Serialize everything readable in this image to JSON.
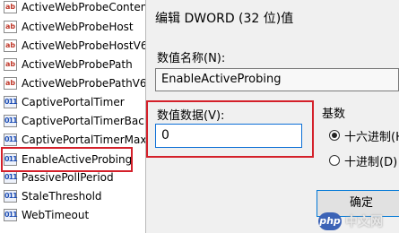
{
  "value_list": {
    "items": [
      {
        "label": "ActiveWebProbeContentV6",
        "type": "sz"
      },
      {
        "label": "ActiveWebProbeHost",
        "type": "sz"
      },
      {
        "label": "ActiveWebProbeHostV6",
        "type": "sz"
      },
      {
        "label": "ActiveWebProbePath",
        "type": "sz"
      },
      {
        "label": "ActiveWebProbePathV6",
        "type": "sz"
      },
      {
        "label": "CaptivePortalTimer",
        "type": "dword"
      },
      {
        "label": "CaptivePortalTimerBack",
        "type": "dword"
      },
      {
        "label": "CaptivePortalTimerMax",
        "type": "dword"
      },
      {
        "label": "EnableActiveProbing",
        "type": "dword"
      },
      {
        "label": "PassivePollPeriod",
        "type": "dword"
      },
      {
        "label": "StaleThreshold",
        "type": "dword"
      },
      {
        "label": "WebTimeout",
        "type": "dword"
      }
    ],
    "icon_text": {
      "sz": "ab",
      "dword": "011"
    },
    "selected_label": "EnableActiveProbing"
  },
  "dialog": {
    "title": "编辑 DWORD (32 位)值",
    "name_label": "数值名称(N):",
    "name_value": "EnableActiveProbing",
    "data_label": "数值数据(V):",
    "data_value": "0",
    "base_label": "基数",
    "radio_hex": "十六进制(H)",
    "radio_dec": "十进制(D)",
    "radio_hex_checked": true,
    "ok_label": "确定"
  },
  "watermark": {
    "logo": "php",
    "text": "中文网"
  },
  "colors": {
    "highlight_border": "#d4202a",
    "focus_border": "#0c6fd6"
  }
}
